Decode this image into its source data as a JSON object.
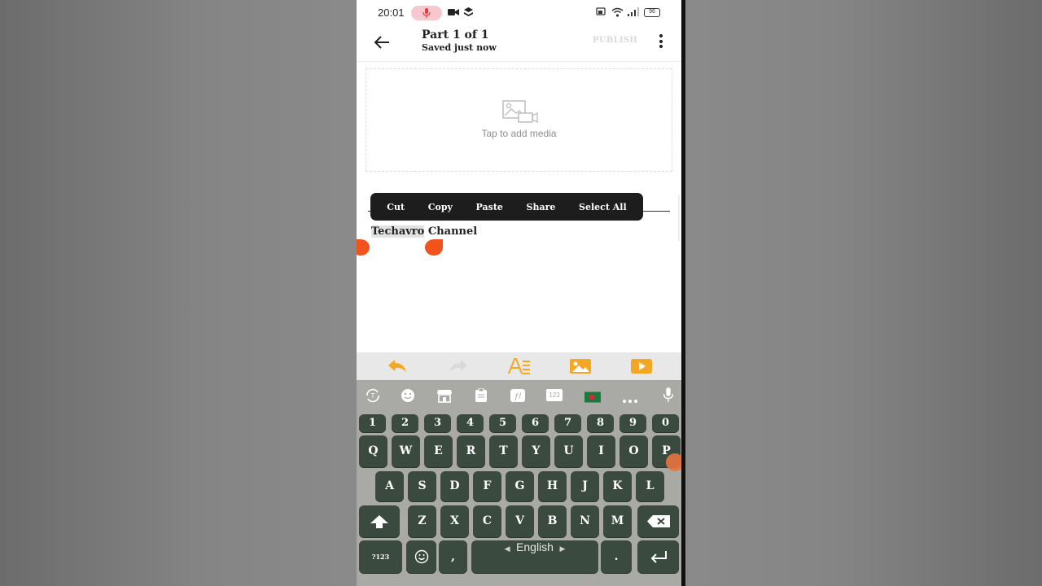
{
  "status_bar": {
    "time": "20:01",
    "battery": "96"
  },
  "header": {
    "title": "Part 1 of 1",
    "subtitle": "Saved just now",
    "publish_label": "PUBLISH"
  },
  "media": {
    "placeholder": "Tap to add media"
  },
  "context_menu": {
    "items": [
      "Cut",
      "Copy",
      "Paste",
      "Share",
      "Select All"
    ]
  },
  "content": {
    "selected_text": "Techavro",
    "rest_text": " Channel"
  },
  "keyboard": {
    "numbers": [
      "1",
      "2",
      "3",
      "4",
      "5",
      "6",
      "7",
      "8",
      "9",
      "0"
    ],
    "row1": [
      "Q",
      "W",
      "E",
      "R",
      "T",
      "Y",
      "U",
      "I",
      "O",
      "P"
    ],
    "row2": [
      "A",
      "S",
      "D",
      "F",
      "G",
      "H",
      "J",
      "K",
      "L"
    ],
    "row3": [
      "Z",
      "X",
      "C",
      "V",
      "B",
      "N",
      "M"
    ],
    "symbols_key": "?123",
    "comma_key": ",",
    "period_key": ".",
    "space_label": "English",
    "toolbar_123": "123"
  },
  "colors": {
    "accent": "#f2531c",
    "toolbar_icon": "#f5a623",
    "key_bg": "#3b4a3e",
    "keyboard_bg": "#a9aaa5"
  }
}
